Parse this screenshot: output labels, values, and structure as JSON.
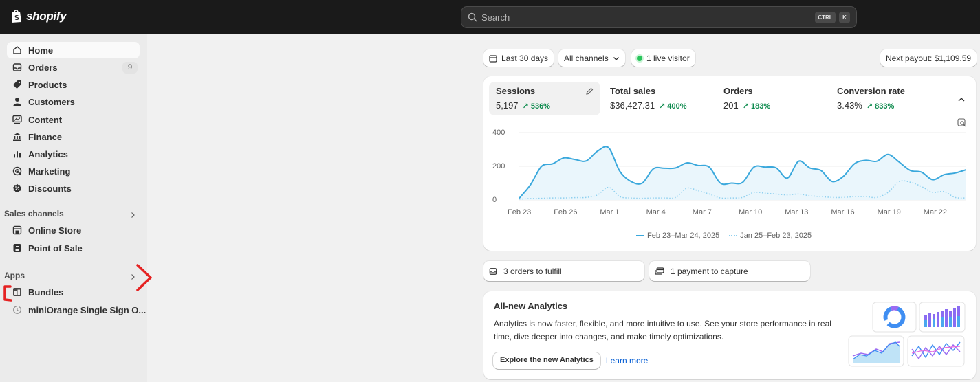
{
  "topbar": {
    "logo_text": "shopify",
    "search_placeholder": "Search",
    "kbd_ctrl": "CTRL",
    "kbd_k": "K"
  },
  "sidebar": {
    "items": [
      {
        "label": "Home",
        "icon": "home-icon",
        "active": true
      },
      {
        "label": "Orders",
        "icon": "inbox-icon",
        "badge": "9"
      },
      {
        "label": "Products",
        "icon": "tag-icon"
      },
      {
        "label": "Customers",
        "icon": "person-icon"
      },
      {
        "label": "Content",
        "icon": "image-icon"
      },
      {
        "label": "Finance",
        "icon": "bank-icon"
      },
      {
        "label": "Analytics",
        "icon": "bar-chart-icon"
      },
      {
        "label": "Marketing",
        "icon": "target-icon"
      },
      {
        "label": "Discounts",
        "icon": "discount-icon"
      }
    ],
    "sales_channels_title": "Sales channels",
    "sales_channels": [
      {
        "label": "Online Store",
        "icon": "store-icon"
      },
      {
        "label": "Point of Sale",
        "icon": "pos-icon"
      }
    ],
    "apps_title": "Apps",
    "apps": [
      {
        "label": "Bundles",
        "icon": "bundles-icon"
      },
      {
        "label": "miniOrange Single Sign O...",
        "icon": "app-placeholder-icon"
      }
    ]
  },
  "toolbar": {
    "date_range": "Last 30 days",
    "channels": "All channels",
    "live_visitors": "1 live visitor",
    "next_payout": "Next payout: $1,109.59"
  },
  "metrics": [
    {
      "title": "Sessions",
      "value": "5,197",
      "delta": "536%"
    },
    {
      "title": "Total sales",
      "value": "$36,427.31",
      "delta": "400%"
    },
    {
      "title": "Orders",
      "value": "201",
      "delta": "183%"
    },
    {
      "title": "Conversion rate",
      "value": "3.43%",
      "delta": "833%"
    }
  ],
  "chart_data": {
    "type": "line",
    "x": [
      "Feb 23",
      "Feb 26",
      "Mar 1",
      "Mar 4",
      "Mar 7",
      "Mar 10",
      "Mar 13",
      "Mar 16",
      "Mar 19",
      "Mar 22"
    ],
    "y_ticks": [
      "400",
      "200",
      "0"
    ],
    "ylim": [
      0,
      400
    ],
    "series": [
      {
        "name": "Feb 23–Mar 24, 2025",
        "style": "solid",
        "color": "#3aa8dc",
        "values": [
          10,
          90,
          200,
          215,
          250,
          240,
          232,
          290,
          310,
          170,
          110,
          100,
          185,
          188,
          190,
          220,
          205,
          195,
          100,
          100,
          105,
          195,
          195,
          190,
          130,
          230,
          190,
          175,
          110,
          140,
          215,
          235,
          230,
          270,
          225,
          175,
          165,
          120,
          150,
          160,
          180
        ]
      },
      {
        "name": "Jan 25–Feb 23, 2025",
        "style": "dotted",
        "color": "#8fd0ef",
        "values": [
          5,
          8,
          10,
          12,
          12,
          14,
          15,
          30,
          75,
          20,
          12,
          10,
          12,
          12,
          15,
          70,
          55,
          35,
          12,
          12,
          15,
          45,
          40,
          35,
          30,
          35,
          25,
          20,
          15,
          15,
          20,
          20,
          15,
          45,
          110,
          105,
          80,
          45,
          50,
          15,
          12
        ]
      }
    ]
  },
  "tasks": [
    {
      "label": "3 orders to fulfill",
      "icon": "inbox-icon"
    },
    {
      "label": "1 payment to capture",
      "icon": "payment-icon"
    }
  ],
  "promo": {
    "title": "All-new Analytics",
    "body": "Analytics is now faster, flexible, and more intuitive to use. See your store performance in real time, dive deeper into changes, and make timely optimizations.",
    "primary_button": "Explore the new Analytics",
    "link": "Learn more"
  }
}
